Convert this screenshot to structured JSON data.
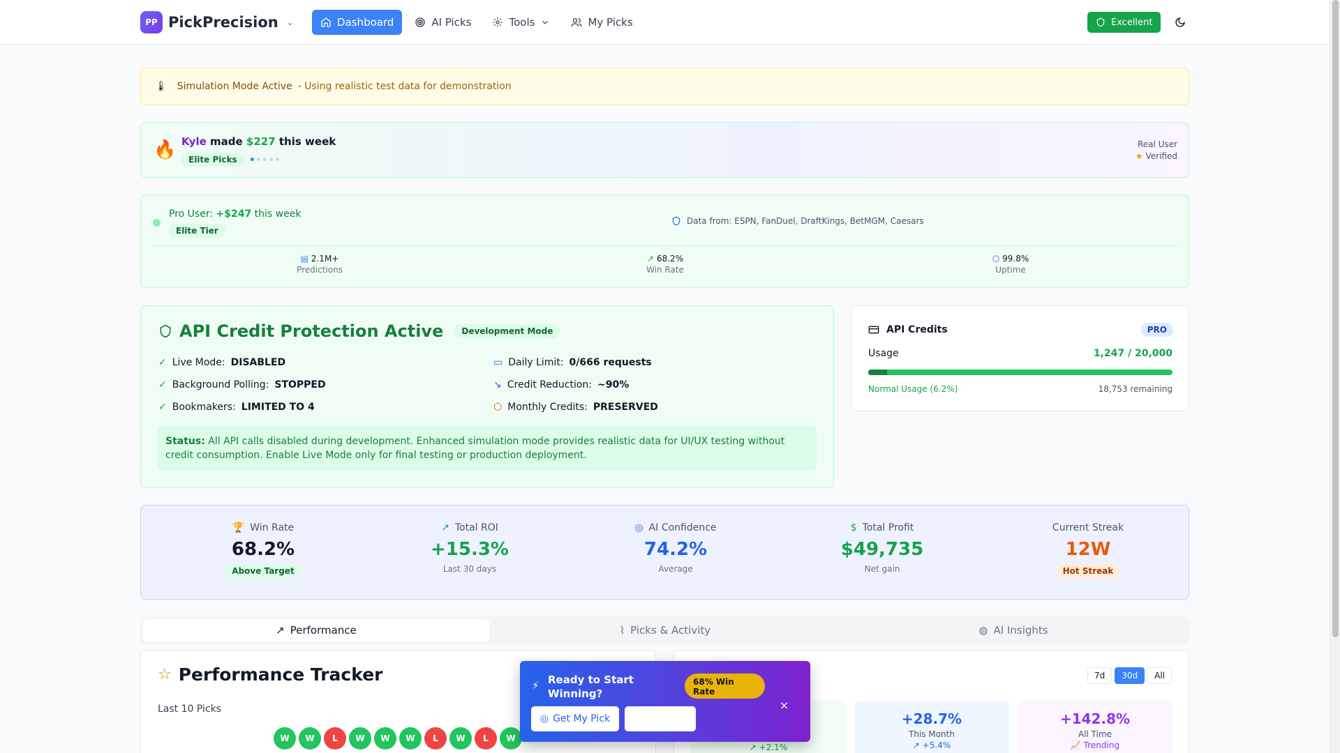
{
  "nav": {
    "logo": "PP",
    "brand": "PickPrecision",
    "items": [
      {
        "label": "Dashboard"
      },
      {
        "label": "AI Picks"
      },
      {
        "label": "Tools"
      },
      {
        "label": "My Picks"
      }
    ],
    "status": "Excellent",
    "theme_icon": "moon-icon"
  },
  "sim": {
    "title": "Simulation Mode Active",
    "detail": "- Using realistic test data for demonstration"
  },
  "social": {
    "name": "Kyle",
    "made": "made",
    "amount": "$227",
    "period": "this week",
    "badge": "Elite Picks",
    "verified_line1": "Real User",
    "verified_line2": "Verified"
  },
  "pro": {
    "prefix": "Pro User:",
    "amount": "+$247",
    "period": "this week",
    "tier": "Elite Tier",
    "sources": "Data from: ESPN, FanDuel, DraftKings, BetMGM, Caesars",
    "stats": [
      {
        "value": "2.1M+",
        "label": "Predictions"
      },
      {
        "value": "68.2%",
        "label": "Win Rate"
      },
      {
        "value": "99.8%",
        "label": "Uptime"
      }
    ]
  },
  "api": {
    "title": "API Credit Protection Active",
    "badge": "Development Mode",
    "rows": [
      {
        "label": "Live Mode:",
        "value": "DISABLED"
      },
      {
        "label": "Background Polling:",
        "value": "STOPPED"
      },
      {
        "label": "Bookmakers:",
        "value": "LIMITED TO 4"
      },
      {
        "label": "Daily Limit:",
        "value": "0/666 requests"
      },
      {
        "label": "Credit Reduction:",
        "value": "~90%"
      },
      {
        "label": "Monthly Credits:",
        "value": "PRESERVED"
      }
    ],
    "status_label": "Status:",
    "status_text": "All API calls disabled during development. Enhanced simulation mode provides realistic data for UI/UX testing without credit consumption. Enable Live Mode only for final testing or production deployment."
  },
  "credits": {
    "title": "API Credits",
    "tier": "PRO",
    "usage_label": "Usage",
    "usage_value": "1,247 / 20,000",
    "usage_fraction": 0.062,
    "note": "Normal Usage (6.2%)",
    "remaining": "18,753 remaining"
  },
  "stats": [
    {
      "label": "Win Rate",
      "value": "68.2%",
      "pill": "Above Target",
      "color": "#111827"
    },
    {
      "label": "Total ROI",
      "value": "+15.3%",
      "sub": "Last 30 days",
      "color": "#16a34a"
    },
    {
      "label": "AI Confidence",
      "value": "74.2%",
      "sub": "Average",
      "color": "#2563eb"
    },
    {
      "label": "Total Profit",
      "value": "$49,735",
      "sub": "Net gain",
      "color": "#16a34a"
    },
    {
      "label": "Current Streak",
      "value": "12W",
      "pill": "Hot Streak",
      "color": "#ea580c"
    }
  ],
  "tabs": [
    {
      "label": "Performance"
    },
    {
      "label": "Picks & Activity"
    },
    {
      "label": "AI Insights"
    }
  ],
  "tracker": {
    "title": "Performance Tracker",
    "last_label": "Last 10 Picks",
    "picks": [
      "W",
      "W",
      "L",
      "W",
      "W",
      "W",
      "L",
      "W",
      "L",
      "W"
    ]
  },
  "ranges": [
    "7d",
    "30d",
    "All"
  ],
  "metrics": [
    {
      "value": "",
      "label": "",
      "delta": "↗ +2.1%"
    },
    {
      "value": "+28.7%",
      "label": "This Month",
      "delta": "↗ +5.4%"
    },
    {
      "value": "+142.8%",
      "label": "All Time",
      "delta": "📈 Trending"
    }
  ],
  "cta": {
    "title": "Ready to Start Winning?",
    "badge": "68% Win Rate",
    "button": "Get My Pick",
    "close": "×"
  }
}
